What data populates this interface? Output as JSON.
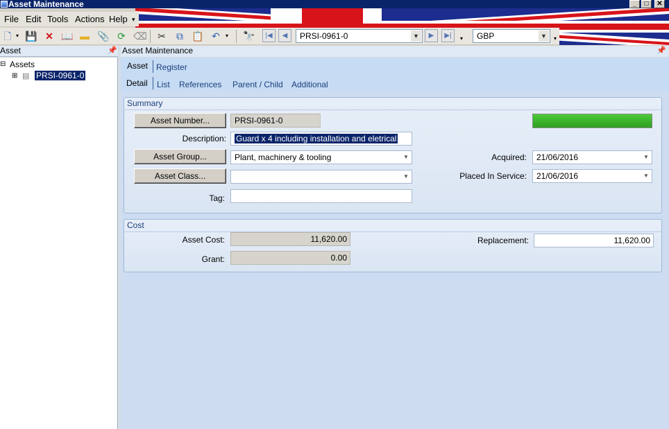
{
  "window": {
    "title": "Asset Maintenance"
  },
  "menu": {
    "items": [
      "File",
      "Edit",
      "Tools",
      "Actions",
      "Help"
    ]
  },
  "toolbar": {
    "record_value": "PRSI-0961-0",
    "currency_value": "GBP"
  },
  "left_panel": {
    "title": "Asset",
    "tree_root": "Assets",
    "tree_child": "PRSI-0961-0"
  },
  "right_panel": {
    "title": "Asset Maintenance",
    "top_tabs": [
      "Asset",
      "Register"
    ],
    "sub_tabs": [
      "Detail",
      "List",
      "References",
      "Parent / Child",
      "Additional"
    ]
  },
  "summary": {
    "title": "Summary",
    "asset_number_button": "Asset Number...",
    "asset_number_value": "PRSI-0961-0",
    "description_label": "Description:",
    "description_value": "Guard x 4 including installation and eletrical",
    "asset_group_button": "Asset Group...",
    "asset_group_value": "Plant, machinery & tooling",
    "asset_class_button": "Asset Class...",
    "asset_class_value": "",
    "tag_label": "Tag:",
    "tag_value": "",
    "acquired_label": "Acquired:",
    "acquired_value": "21/06/2016",
    "placed_label": "Placed In Service:",
    "placed_value": "21/06/2016",
    "status_color": "#4cc93a"
  },
  "cost": {
    "title": "Cost",
    "asset_cost_label": "Asset Cost:",
    "asset_cost_value": "11,620.00",
    "grant_label": "Grant:",
    "grant_value": "0.00",
    "replacement_label": "Replacement:",
    "replacement_value": "11,620.00"
  }
}
